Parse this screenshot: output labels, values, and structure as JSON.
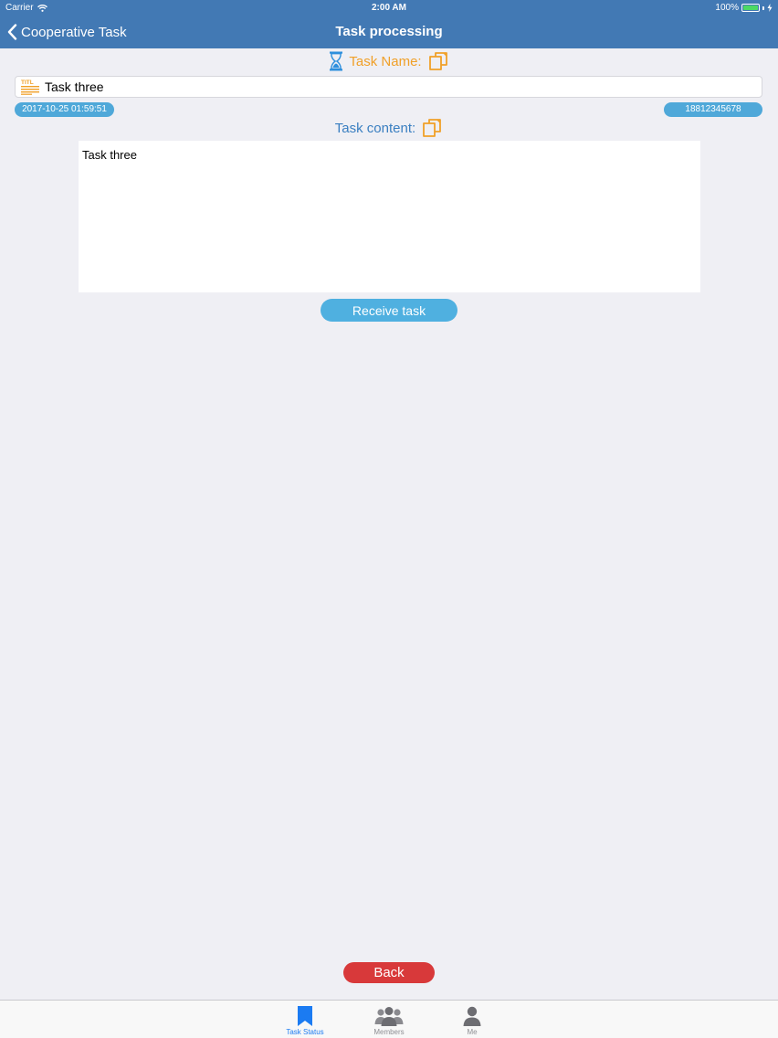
{
  "status_bar": {
    "carrier": "Carrier",
    "time": "2:00 AM",
    "battery": "100%"
  },
  "nav": {
    "back_label": "Cooperative Task",
    "title": "Task processing"
  },
  "task_name": {
    "label": "Task Name:",
    "value": "Task three",
    "icon": "hourglass-icon",
    "title_icon": "title-icon"
  },
  "meta": {
    "date": "2017-10-25 01:59:51",
    "phone": "18812345678"
  },
  "task_content": {
    "label": "Task content:",
    "value": "Task three"
  },
  "actions": {
    "receive_label": "Receive task",
    "back_label": "Back"
  },
  "tabs": [
    {
      "label": "Task Status",
      "icon": "bookmark-icon",
      "active": true
    },
    {
      "label": "Members",
      "icon": "members-icon",
      "active": false
    },
    {
      "label": "Me",
      "icon": "person-icon",
      "active": false
    }
  ],
  "colors": {
    "nav_bg": "#4279b4",
    "accent_orange": "#f0a028",
    "accent_blue": "#3a7fc1",
    "pill_blue": "#4fa8d9",
    "receive_button": "#4fb0e0",
    "back_button": "#d8393a",
    "tab_active": "#1b7bf2"
  }
}
